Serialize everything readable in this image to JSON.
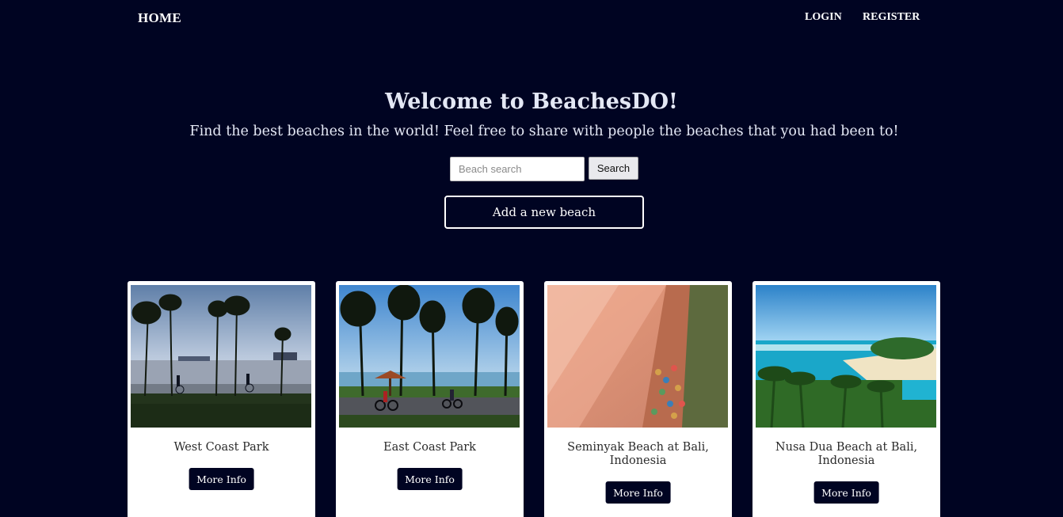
{
  "nav": {
    "home": "HOME",
    "login": "LOGIN",
    "register": "REGISTER"
  },
  "hero": {
    "title": "Welcome to BeachesDO!",
    "subtitle": "Find the best beaches in the world! Feel free to share with people the beaches that you had been to!",
    "search_placeholder": "Beach search",
    "search_value": "",
    "search_button": "Search",
    "add_button": "Add a new beach"
  },
  "beaches": [
    {
      "name": "West Coast Park",
      "button": "More Info"
    },
    {
      "name": "East Coast Park",
      "button": "More Info"
    },
    {
      "name": "Seminyak Beach at Bali, Indonesia",
      "button": "More Info"
    },
    {
      "name": "Nusa Dua Beach at Bali, Indonesia",
      "button": "More Info"
    }
  ]
}
